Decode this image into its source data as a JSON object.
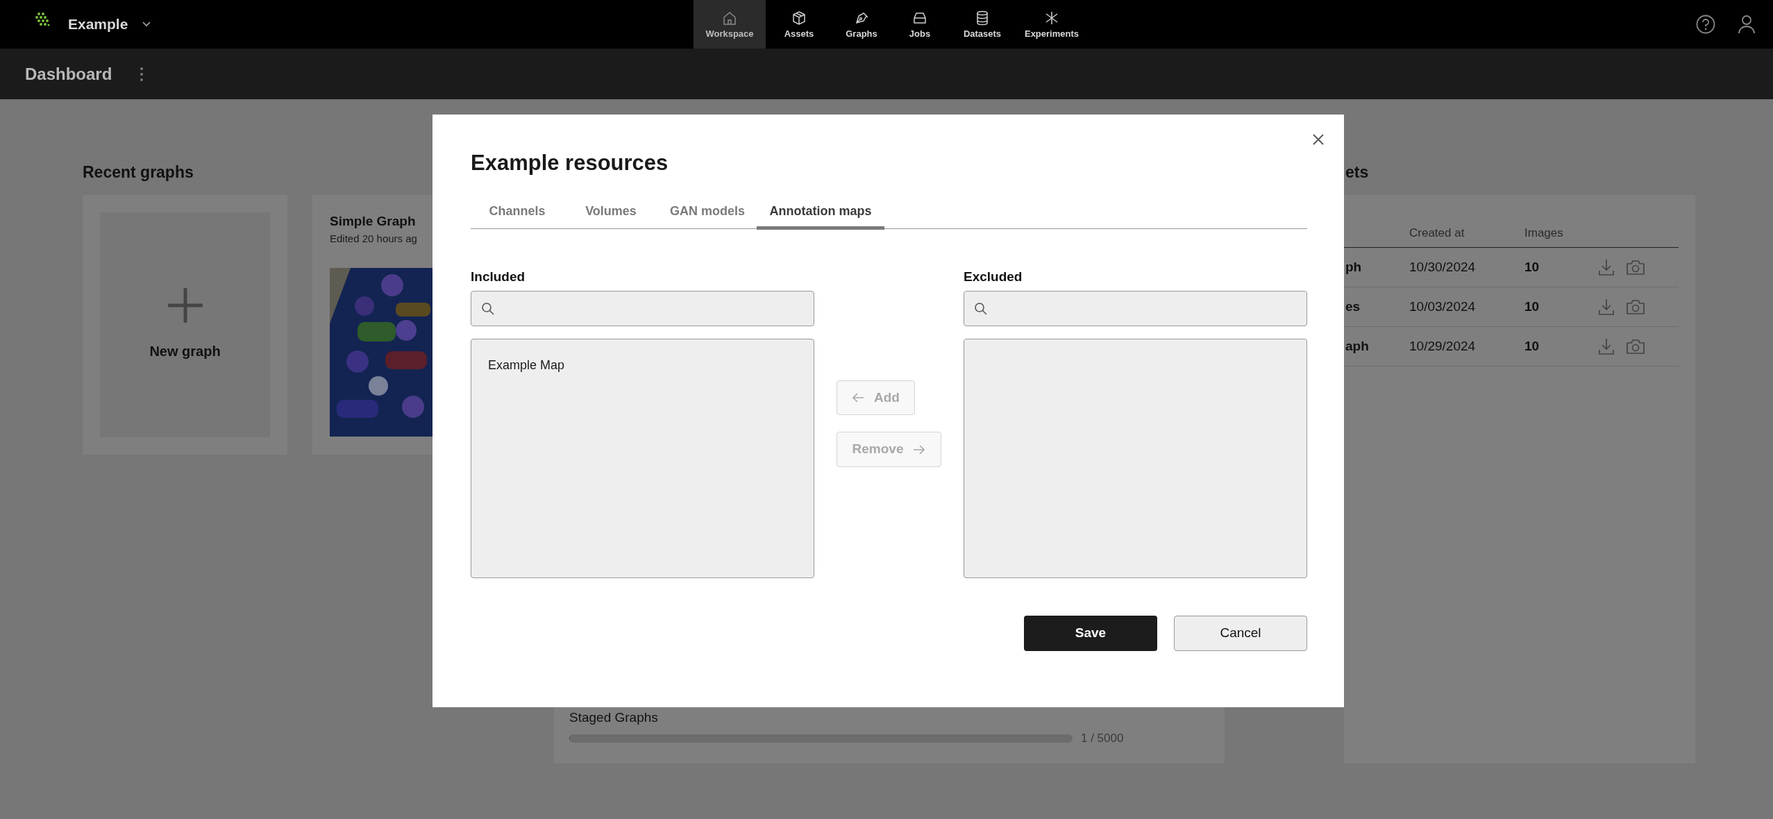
{
  "header": {
    "brand": "Example",
    "nav": [
      {
        "label": "Workspace",
        "selected": true
      },
      {
        "label": "Assets",
        "selected": false
      },
      {
        "label": "Graphs",
        "selected": false
      },
      {
        "label": "Jobs",
        "selected": false
      },
      {
        "label": "Datasets",
        "selected": false
      },
      {
        "label": "Experiments",
        "selected": false
      }
    ]
  },
  "subheader": {
    "title": "Dashboard"
  },
  "recent_graphs": {
    "title": "Recent graphs",
    "new_graph": "New graph",
    "cards": [
      {
        "title": "Simple Graph",
        "subtitle": "Edited 20 hours ag"
      }
    ]
  },
  "staged": {
    "label": "Staged Graphs",
    "level": 0.0002,
    "reading": "1 / 5000"
  },
  "datasets": {
    "title": "ets",
    "columns": [
      "Created at",
      "Images"
    ],
    "rows": [
      {
        "name": "ph",
        "created": "10/30/2024",
        "images": "10"
      },
      {
        "name": "es",
        "created": "10/03/2024",
        "images": "10"
      },
      {
        "name": "aph",
        "created": "10/29/2024",
        "images": "10"
      }
    ]
  },
  "dialog": {
    "title": "Example resources",
    "tabs": [
      {
        "label": "Channels",
        "selected": false
      },
      {
        "label": "Volumes",
        "selected": false
      },
      {
        "label": "GAN models",
        "selected": false
      },
      {
        "label": "Annotation maps",
        "selected": true
      }
    ],
    "included": {
      "label": "Included",
      "items": [
        "Example Map"
      ]
    },
    "excluded": {
      "label": "Excluded"
    },
    "add": {
      "label": "Add",
      "disabled": true
    },
    "remove": {
      "label": "Remove",
      "disabled": true
    },
    "save": "Save",
    "cancel": "Cancel"
  }
}
